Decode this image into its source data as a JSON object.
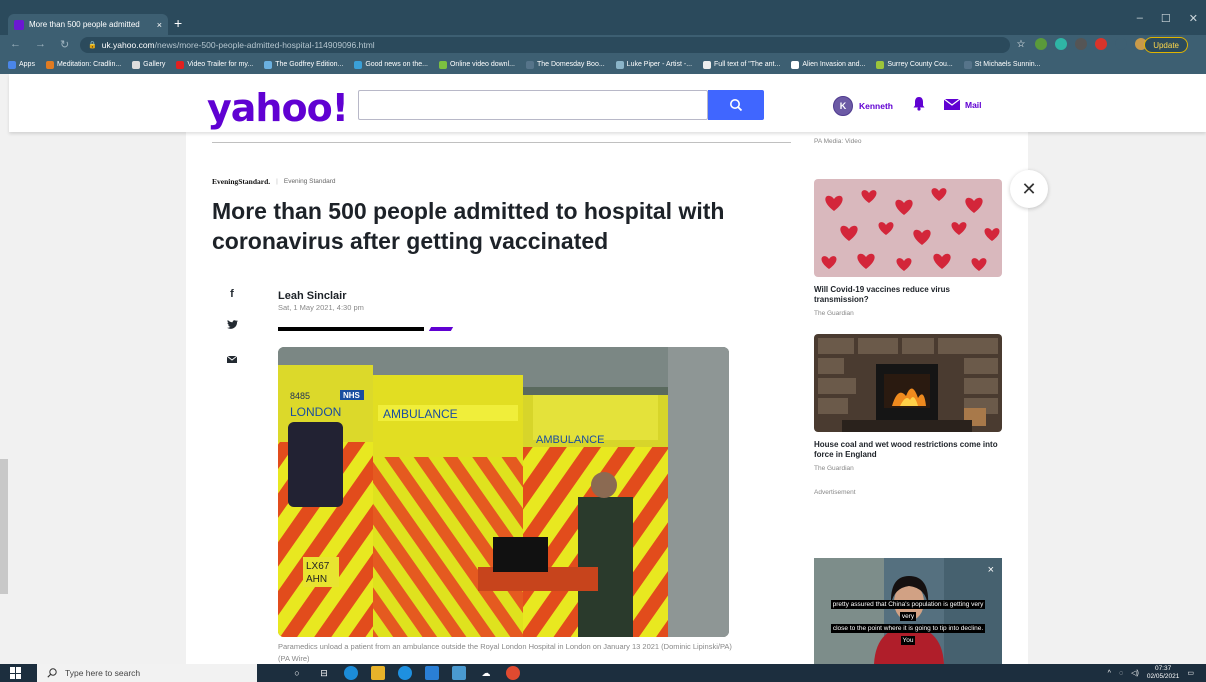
{
  "browser": {
    "tab_title": "More than 500 people admitted",
    "tab_close": "×",
    "new_tab": "+",
    "url_host": "uk.yahoo.com",
    "url_path": "/news/more-500-people-admitted-hospital-114909096.html",
    "update_label": "Update",
    "window_controls": [
      "–",
      "☐",
      "✕"
    ],
    "bookmarks": [
      "Apps",
      "Meditation: Cradlin...",
      "Gallery",
      "Video Trailer for my...",
      "The Godfrey Edition...",
      "Good news on the...",
      "Online video downl...",
      "The Domesday Boo...",
      "Luke Piper - Artist -...",
      "Full text of \"The ant...",
      "Alien Invasion and...",
      "Surrey County Cou...",
      "St Michaels Sunnin..."
    ]
  },
  "yahoo": {
    "logo": "yahoo!",
    "search_placeholder": "",
    "user_name": "Kenneth",
    "avatar_letter": "K",
    "mail_label": "Mail"
  },
  "article": {
    "publisher_logo": "EveningStandard.",
    "publisher_name": "Evening Standard",
    "headline": "More than 500 people admitted to hospital with coronavirus after getting vaccinated",
    "author": "Leah Sinclair",
    "date": "Sat, 1 May 2021, 4:30 pm",
    "photo_texts": {
      "fleet_no": "8485",
      "nhs": "NHS",
      "london": "LONDON",
      "ambulance1": "AMBULANCE",
      "ambulance2": "AMBULANCE",
      "plate1": "LX67",
      "plate2": "AHN"
    },
    "caption": "Paramedics unload a patient from an ambulance outside the Royal London Hospital in London on January 13 2021 (Dominic Lipinski/PA) (PA Wire)"
  },
  "sidebar": {
    "top_source": "PA Media: Video",
    "items": [
      {
        "title": "Will Covid-19 vaccines reduce virus transmission?",
        "source": "The Guardian"
      },
      {
        "title": "House coal and wet wood restrictions come into force in England",
        "source": "The Guardian"
      }
    ],
    "ad_label": "Advertisement",
    "video_close": "×",
    "subtitles": [
      "pretty assured that China's population is getting very",
      "very",
      "close to the point where it is going to tip into decline.",
      "You"
    ]
  },
  "taskbar": {
    "search_placeholder": "Type here to search",
    "time": "07:37",
    "date": "02/05/2021"
  },
  "colors": {
    "yahoo_purple": "#6001d2",
    "search_blue": "#4066ff",
    "chrome_dark": "#2b4a5c"
  }
}
